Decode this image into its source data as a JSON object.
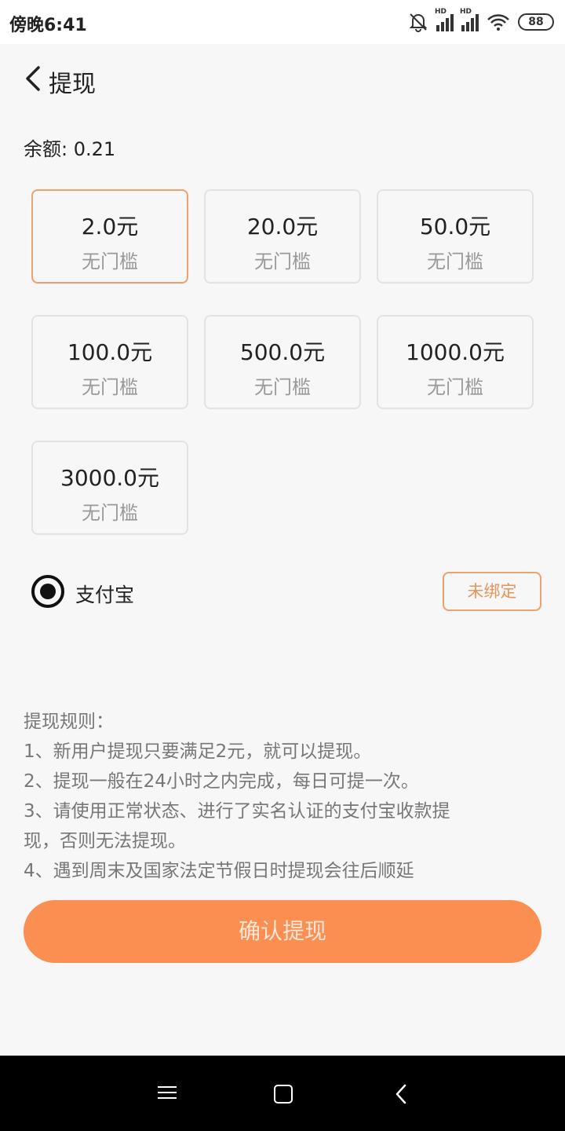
{
  "status_bar": {
    "time": "傍晚6:41",
    "hd1": "HD",
    "hd2": "HD",
    "battery": "88"
  },
  "header": {
    "title": "提现"
  },
  "balance_text": "余额: 0.21",
  "amounts": [
    {
      "value": "2.0元",
      "sub": "无门槛",
      "selected": true
    },
    {
      "value": "20.0元",
      "sub": "无门槛"
    },
    {
      "value": "50.0元",
      "sub": "无门槛"
    },
    {
      "value": "100.0元",
      "sub": "无门槛"
    },
    {
      "value": "500.0元",
      "sub": "无门槛"
    },
    {
      "value": "1000.0元",
      "sub": "无门槛"
    },
    {
      "value": "3000.0元",
      "sub": "无门槛"
    }
  ],
  "payment": {
    "method": "支付宝",
    "bind_label": "未绑定"
  },
  "rules": {
    "title": "提现规则：",
    "lines": [
      "1、新用户提现只要满足2元，就可以提现。",
      "2、提现一般在24小时之内完成，每日可提一次。",
      "3、请使用正常状态、进行了实名认证的支付宝收款提",
      "现，否则无法提现。",
      "4、遇到周末及国家法定节假日时提现会往后顺延"
    ]
  },
  "confirm_label": "确认提现",
  "colors": {
    "accent": "#fb8f52",
    "selected_border": "#f0a06a"
  }
}
